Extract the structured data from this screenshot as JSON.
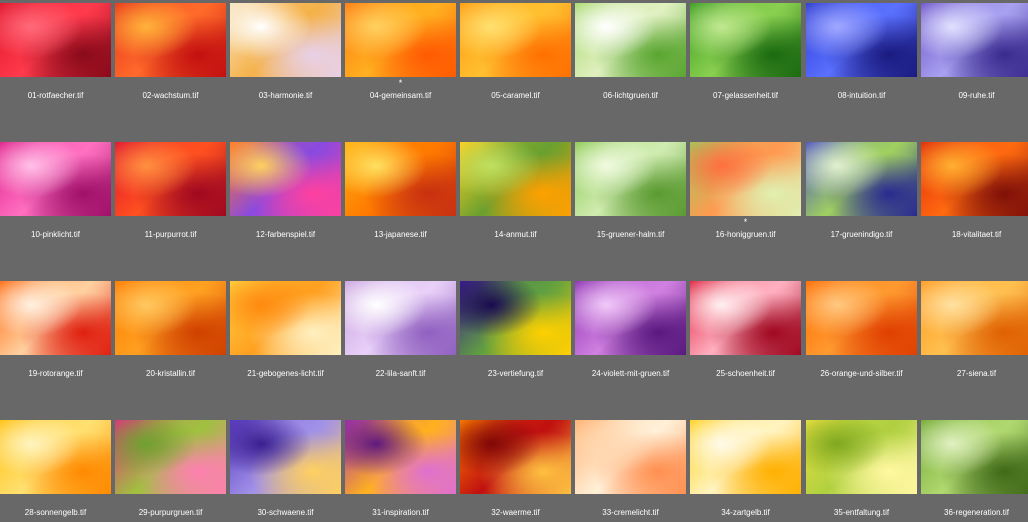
{
  "grid": {
    "items": [
      {
        "filename": "01-rotfaecher.tif",
        "rating": "",
        "colors": [
          "#e0142a",
          "#ff3a4c",
          "#8a0a1a",
          "#ff6a7a"
        ]
      },
      {
        "filename": "02-wachstum.tif",
        "rating": "",
        "colors": [
          "#e8341c",
          "#ff6a2a",
          "#c41010",
          "#ffb23a"
        ]
      },
      {
        "filename": "03-harmonie.tif",
        "rating": "",
        "colors": [
          "#f7e4c0",
          "#f5b24a",
          "#e8d0e8",
          "#ffffff"
        ]
      },
      {
        "filename": "04-gemeinsam.tif",
        "rating": "*",
        "colors": [
          "#ff7a10",
          "#ffb020",
          "#ff5a00",
          "#ffd060"
        ]
      },
      {
        "filename": "05-caramel.tif",
        "rating": "",
        "colors": [
          "#ff9a10",
          "#ffc030",
          "#ff7000",
          "#ffe070"
        ]
      },
      {
        "filename": "06-lichtgruen.tif",
        "rating": "",
        "colors": [
          "#a6d86a",
          "#e0f0c0",
          "#5aa630",
          "#ffffff"
        ]
      },
      {
        "filename": "07-gelassenheit.tif",
        "rating": "",
        "colors": [
          "#3a9a20",
          "#8ad050",
          "#1a6a10",
          "#c0e890"
        ]
      },
      {
        "filename": "08-intuition.tif",
        "rating": "",
        "colors": [
          "#2a3ad0",
          "#5a70ff",
          "#1a1a80",
          "#a0a8ff"
        ]
      },
      {
        "filename": "09-ruhe.tif",
        "rating": "",
        "colors": [
          "#6a50c8",
          "#a8a0f0",
          "#3a2a90",
          "#e0e0ff"
        ]
      },
      {
        "filename": "10-pinklicht.tif",
        "rating": "",
        "colors": [
          "#e0208a",
          "#ff70c0",
          "#a0106a",
          "#ffc0e8"
        ]
      },
      {
        "filename": "11-purpurrot.tif",
        "rating": "",
        "colors": [
          "#e01030",
          "#ff5020",
          "#a00820",
          "#ff9040"
        ]
      },
      {
        "filename": "12-farbenspiel.tif",
        "rating": "",
        "colors": [
          "#ff7a20",
          "#8a4ae0",
          "#ff40a0",
          "#ffd060"
        ]
      },
      {
        "filename": "13-japanese.tif",
        "rating": "",
        "colors": [
          "#ffb010",
          "#ff7a00",
          "#c83010",
          "#ffe060"
        ]
      },
      {
        "filename": "14-anmut.tif",
        "rating": "",
        "colors": [
          "#ffd020",
          "#6aa030",
          "#ffa000",
          "#c0e060"
        ]
      },
      {
        "filename": "15-gruener-halm.tif",
        "rating": "",
        "colors": [
          "#8ac850",
          "#d0ecb0",
          "#5a9a30",
          "#f0fae0"
        ]
      },
      {
        "filename": "16-honiggruen.tif",
        "rating": "*",
        "colors": [
          "#a0c860",
          "#ff9a50",
          "#e0f0b0",
          "#ff7040"
        ]
      },
      {
        "filename": "17-gruenindigo.tif",
        "rating": "",
        "colors": [
          "#4a50c0",
          "#a0d060",
          "#2a2a90",
          "#e0f0d0"
        ]
      },
      {
        "filename": "18-vitalitaet.tif",
        "rating": "",
        "colors": [
          "#e0280a",
          "#ff6a10",
          "#801008",
          "#ffb030"
        ]
      },
      {
        "filename": "19-rotorange.tif",
        "rating": "",
        "colors": [
          "#ff6a10",
          "#ffd0a0",
          "#e02010",
          "#fff0e0"
        ]
      },
      {
        "filename": "20-kristallin.tif",
        "rating": "",
        "colors": [
          "#ff7a00",
          "#ffa020",
          "#d04000",
          "#ffc860"
        ]
      },
      {
        "filename": "21-gebogenes-licht.tif",
        "rating": "",
        "colors": [
          "#ffd040",
          "#ffa020",
          "#fff0c0",
          "#ff8a10"
        ]
      },
      {
        "filename": "22-lila-sanft.tif",
        "rating": "",
        "colors": [
          "#c8a0e0",
          "#e8d0f8",
          "#9060c0",
          "#ffffff"
        ]
      },
      {
        "filename": "23-vertiefung.tif",
        "rating": "",
        "colors": [
          "#3a1a90",
          "#60a040",
          "#ffd000",
          "#1a0a50"
        ]
      },
      {
        "filename": "24-violett-mit-gruen.tif",
        "rating": "",
        "colors": [
          "#8a30b0",
          "#d080e0",
          "#5a1880",
          "#f0c8f8"
        ]
      },
      {
        "filename": "25-schoenheit.tif",
        "rating": "",
        "colors": [
          "#e02040",
          "#ffb0c0",
          "#a00820",
          "#fff0f0"
        ]
      },
      {
        "filename": "26-orange-und-silber.tif",
        "rating": "",
        "colors": [
          "#ff6a00",
          "#ff9a30",
          "#e04000",
          "#ffc880"
        ]
      },
      {
        "filename": "27-siena.tif",
        "rating": "",
        "colors": [
          "#ff9a20",
          "#ffc050",
          "#e06000",
          "#ffe0a0"
        ]
      },
      {
        "filename": "28-sonnengelb.tif",
        "rating": "",
        "colors": [
          "#ffc010",
          "#ffe070",
          "#ff8a00",
          "#fff4c0"
        ]
      },
      {
        "filename": "29-purpurgruen.tif",
        "rating": "",
        "colors": [
          "#e03080",
          "#a0c040",
          "#ff80b0",
          "#70a030"
        ]
      },
      {
        "filename": "30-schwaene.tif",
        "rating": "",
        "colors": [
          "#5a3ac0",
          "#a090e8",
          "#ffd060",
          "#3a2090"
        ]
      },
      {
        "filename": "31-inspiration.tif",
        "rating": "",
        "colors": [
          "#a030b0",
          "#ffb020",
          "#e070d0",
          "#601880"
        ]
      },
      {
        "filename": "32-waerme.tif",
        "rating": "",
        "colors": [
          "#ff8000",
          "#c01010",
          "#ffc040",
          "#800808"
        ]
      },
      {
        "filename": "33-cremelicht.tif",
        "rating": "",
        "colors": [
          "#ffb070",
          "#fff0d8",
          "#ff9050",
          "#ffd8b0"
        ]
      },
      {
        "filename": "34-zartgelb.tif",
        "rating": "",
        "colors": [
          "#ffd020",
          "#fff4c0",
          "#ffb000",
          "#fffae8"
        ]
      },
      {
        "filename": "35-entfaltung.tif",
        "rating": "",
        "colors": [
          "#e8e040",
          "#b0d040",
          "#fff8a0",
          "#80a820"
        ]
      },
      {
        "filename": "36-regeneration.tif",
        "rating": "",
        "colors": [
          "#70a830",
          "#b0d870",
          "#406a18",
          "#e0f0c0"
        ]
      }
    ]
  }
}
